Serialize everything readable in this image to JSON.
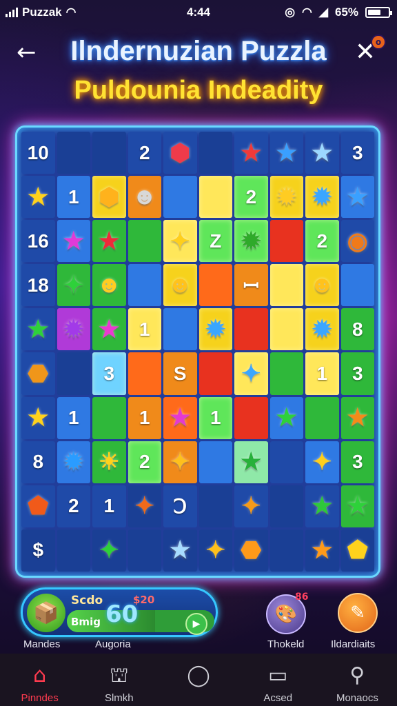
{
  "status_bar": {
    "carrier": "Puzzak",
    "time": "4:44",
    "battery": "65%",
    "battery_level": 0.65
  },
  "header": {
    "title": "Ilndernuzian Puzzla",
    "subtitle": "Puldounia Indeadity",
    "close_badge": "o"
  },
  "board": {
    "colors": {
      "b": "#1f4aa8",
      "d": "#1a3f95",
      "B": "#2f79e3",
      "l": "#6fd3ff",
      "g": "#2fb83a",
      "G": "#5fe65a",
      "y": "#f6d21c",
      "Y": "#ffe75a",
      "o": "#f08a1a",
      "O": "#ff6a1a",
      "r": "#e8321f",
      "R": "#c41f2a",
      "p": "#b03ad8",
      "c": "#8fe8a8"
    },
    "rows": [
      [
        {
          "c": "b",
          "t": "10"
        },
        {
          "c": "d",
          "t": ""
        },
        {
          "c": "d",
          "t": ""
        },
        {
          "c": "b",
          "t": "2"
        },
        {
          "c": "b",
          "t": "",
          "i": "red-blob",
          "ic": "#ef3b4a"
        },
        {
          "c": "d",
          "t": ""
        },
        {
          "c": "b",
          "t": "",
          "i": "red-star",
          "ic": "#f03a3a"
        },
        {
          "c": "b",
          "t": "",
          "i": "blue-star",
          "ic": "#3aa0ff"
        },
        {
          "c": "b",
          "t": "",
          "i": "light-star",
          "ic": "#9cd8ff"
        },
        {
          "c": "b",
          "t": "3"
        }
      ],
      [
        {
          "c": "b",
          "t": "",
          "i": "yellow-star",
          "ic": "#ffd21c"
        },
        {
          "c": "B",
          "t": "1"
        },
        {
          "c": "y",
          "t": "",
          "i": "yellow-blob",
          "ic": "#ffb21c"
        },
        {
          "c": "o",
          "t": "",
          "i": "gray-monster",
          "ic": "#d8d8d8"
        },
        {
          "c": "B",
          "t": ""
        },
        {
          "c": "Y",
          "t": ""
        },
        {
          "c": "G",
          "t": "2"
        },
        {
          "c": "y",
          "t": "",
          "i": "yellow-splat",
          "ic": "#ffcc22"
        },
        {
          "c": "y",
          "t": "",
          "i": "blue-splat",
          "ic": "#3aa6ff"
        },
        {
          "c": "B",
          "t": "",
          "i": "blue-star",
          "ic": "#3aa0ff"
        }
      ],
      [
        {
          "c": "b",
          "t": "16"
        },
        {
          "c": "B",
          "t": "",
          "i": "magenta-star",
          "ic": "#e03ad8"
        },
        {
          "c": "g",
          "t": "",
          "i": "red-star",
          "ic": "#ee2a3a"
        },
        {
          "c": "g",
          "t": ""
        },
        {
          "c": "Y",
          "t": "",
          "i": "yellow-sparkle",
          "ic": "#ffcf1c"
        },
        {
          "c": "G",
          "t": "Z"
        },
        {
          "c": "G",
          "t": "",
          "i": "green-splat",
          "ic": "#2faa2a"
        },
        {
          "c": "r",
          "t": ""
        },
        {
          "c": "G",
          "t": "2"
        },
        {
          "c": "b",
          "t": "",
          "i": "orange-ring",
          "ic": "#f07a1a"
        }
      ],
      [
        {
          "c": "b",
          "t": "18"
        },
        {
          "c": "g",
          "t": "",
          "i": "green-sparkle",
          "ic": "#2ed13a"
        },
        {
          "c": "g",
          "t": "",
          "i": "yellow-chick",
          "ic": "#ffcc22"
        },
        {
          "c": "B",
          "t": ""
        },
        {
          "c": "y",
          "t": "",
          "i": "yellow-monster",
          "ic": "#ffc21c"
        },
        {
          "c": "O",
          "t": ""
        },
        {
          "c": "o",
          "t": "ꟷ"
        },
        {
          "c": "Y",
          "t": ""
        },
        {
          "c": "y",
          "t": "",
          "i": "yellow-monster",
          "ic": "#ffc21c"
        },
        {
          "c": "B",
          "t": ""
        }
      ],
      [
        {
          "c": "b",
          "t": "",
          "i": "green-star",
          "ic": "#2ed13a"
        },
        {
          "c": "p",
          "t": "",
          "i": "purple-splat",
          "ic": "#a23ae8"
        },
        {
          "c": "g",
          "t": "",
          "i": "magenta-star",
          "ic": "#ea3ad0"
        },
        {
          "c": "Y",
          "t": "1"
        },
        {
          "c": "B",
          "t": ""
        },
        {
          "c": "y",
          "t": "",
          "i": "blue-splat",
          "ic": "#3aa6ff"
        },
        {
          "c": "r",
          "t": ""
        },
        {
          "c": "Y",
          "t": ""
        },
        {
          "c": "y",
          "t": "",
          "i": "blue-splat",
          "ic": "#3aa6ff"
        },
        {
          "c": "g",
          "t": "8"
        }
      ],
      [
        {
          "c": "b",
          "t": "",
          "i": "orange-cookie",
          "ic": "#f0961a"
        },
        {
          "c": "d",
          "t": ""
        },
        {
          "c": "l",
          "t": "3"
        },
        {
          "c": "O",
          "t": ""
        },
        {
          "c": "o",
          "t": "S"
        },
        {
          "c": "r",
          "t": ""
        },
        {
          "c": "Y",
          "t": "",
          "i": "blue-sparkle",
          "ic": "#3aa6ff"
        },
        {
          "c": "g",
          "t": ""
        },
        {
          "c": "Y",
          "t": "1"
        },
        {
          "c": "g",
          "t": "3"
        }
      ],
      [
        {
          "c": "b",
          "t": "",
          "i": "yellow-star",
          "ic": "#ffd21c"
        },
        {
          "c": "B",
          "t": "1"
        },
        {
          "c": "g",
          "t": ""
        },
        {
          "c": "o",
          "t": "1"
        },
        {
          "c": "O",
          "t": "",
          "i": "magenta-star",
          "ic": "#e43ad0"
        },
        {
          "c": "G",
          "t": "1"
        },
        {
          "c": "r",
          "t": ""
        },
        {
          "c": "B",
          "t": "",
          "i": "green-star",
          "ic": "#2ed13a"
        },
        {
          "c": "g",
          "t": ""
        },
        {
          "c": "g",
          "t": "",
          "i": "orange-star",
          "ic": "#f58a1a"
        }
      ],
      [
        {
          "c": "b",
          "t": "8"
        },
        {
          "c": "B",
          "t": "",
          "i": "blue-splat",
          "ic": "#2a9cff"
        },
        {
          "c": "g",
          "t": "",
          "i": "yellow-sun",
          "ic": "#ffd21c"
        },
        {
          "c": "G",
          "t": "2"
        },
        {
          "c": "o",
          "t": "",
          "i": "yellow-sparkle",
          "ic": "#ffc01c"
        },
        {
          "c": "B",
          "t": ""
        },
        {
          "c": "c",
          "t": "",
          "i": "green-star",
          "ic": "#27b03a"
        },
        {
          "c": "b",
          "t": ""
        },
        {
          "c": "B",
          "t": "",
          "i": "yellow-sparkle",
          "ic": "#ffcf1c"
        },
        {
          "c": "g",
          "t": "3"
        }
      ],
      [
        {
          "c": "b",
          "t": "",
          "i": "orange-shape",
          "ic": "#f05a1a"
        },
        {
          "c": "b",
          "t": "2"
        },
        {
          "c": "b",
          "t": "1"
        },
        {
          "c": "d",
          "t": "",
          "i": "orange-sparkle",
          "ic": "#f06a1a"
        },
        {
          "c": "b",
          "t": "Ↄ"
        },
        {
          "c": "d",
          "t": ""
        },
        {
          "c": "b",
          "t": "",
          "i": "orange-sparkle",
          "ic": "#f59a1a"
        },
        {
          "c": "d",
          "t": ""
        },
        {
          "c": "b",
          "t": "",
          "i": "green-star",
          "ic": "#2ec83a"
        },
        {
          "c": "g",
          "t": "",
          "i": "green-star",
          "ic": "#2ed13a"
        }
      ],
      [
        {
          "c": "d",
          "t": "$"
        },
        {
          "c": "d",
          "t": ""
        },
        {
          "c": "d",
          "t": "",
          "i": "green-sparkle",
          "ic": "#2ed13a"
        },
        {
          "c": "d",
          "t": ""
        },
        {
          "c": "d",
          "t": "",
          "i": "light-star",
          "ic": "#a8dcff"
        },
        {
          "c": "d",
          "t": "",
          "i": "yellow-sparkle",
          "ic": "#ffc01c"
        },
        {
          "c": "d",
          "t": "",
          "i": "orange-cookie",
          "ic": "#ff9a1a"
        },
        {
          "c": "d",
          "t": ""
        },
        {
          "c": "d",
          "t": "",
          "i": "orange-star",
          "ic": "#ff9a1a"
        },
        {
          "c": "d",
          "t": "",
          "i": "yellow-shape",
          "ic": "#ffd21c"
        }
      ]
    ]
  },
  "score_panel": {
    "label_top": "Scdo",
    "label_bottom": "Bmig",
    "value": "60",
    "bonus": "$20",
    "progress": 0.6
  },
  "buttons": {
    "left_label": "Mandes",
    "mid_label": "Augoria",
    "thoard_label": "Thokeld",
    "thoard_badge": "86",
    "ideas_label": "Ildardiaits"
  },
  "nav": [
    {
      "label": "Pinndes",
      "icon": "home-icon",
      "active": true
    },
    {
      "label": "Slmkh",
      "icon": "shop-icon",
      "active": false
    },
    {
      "label": "",
      "icon": "circle-icon",
      "active": false
    },
    {
      "label": "Acsed",
      "icon": "tv-icon",
      "active": false
    },
    {
      "label": "Monaocs",
      "icon": "search-icon",
      "active": false
    }
  ]
}
